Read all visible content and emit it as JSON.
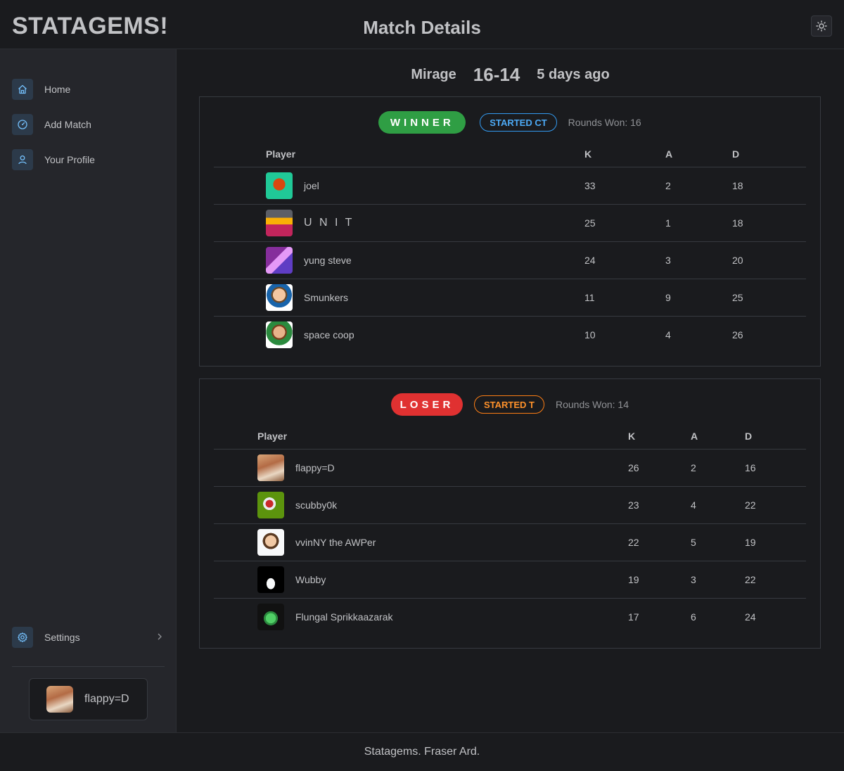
{
  "app": {
    "brand": "STATAGEMS!",
    "page_title": "Match Details"
  },
  "sidebar": {
    "items": [
      {
        "label": "Home",
        "icon": "home-icon"
      },
      {
        "label": "Add Match",
        "icon": "gauge-icon"
      },
      {
        "label": "Your Profile",
        "icon": "user-icon"
      }
    ],
    "settings": {
      "label": "Settings",
      "icon": "gear-icon"
    },
    "user": {
      "name": "flappy=D"
    }
  },
  "match": {
    "map": "Mirage",
    "score": "16-14",
    "time_ago": "5 days ago"
  },
  "columns": {
    "player": "Player",
    "k": "K",
    "a": "A",
    "d": "D"
  },
  "teams": [
    {
      "result": "WINNER",
      "side": "STARTED CT",
      "rounds_won": "Rounds Won: 16",
      "players": [
        {
          "name": "joel",
          "k": "33",
          "a": "2",
          "d": "18"
        },
        {
          "name": "U N I T",
          "k": "25",
          "a": "1",
          "d": "18"
        },
        {
          "name": "yung steve",
          "k": "24",
          "a": "3",
          "d": "20"
        },
        {
          "name": "Smunkers",
          "k": "11",
          "a": "9",
          "d": "25"
        },
        {
          "name": "space coop",
          "k": "10",
          "a": "4",
          "d": "26"
        }
      ]
    },
    {
      "result": "LOSER",
      "side": "STARTED T",
      "rounds_won": "Rounds Won: 14",
      "players": [
        {
          "name": "flappy=D",
          "k": "26",
          "a": "2",
          "d": "16"
        },
        {
          "name": "scubby0k",
          "k": "23",
          "a": "4",
          "d": "22"
        },
        {
          "name": "vvinNY the AWPer",
          "k": "22",
          "a": "5",
          "d": "19"
        },
        {
          "name": "Wubby",
          "k": "19",
          "a": "3",
          "d": "22"
        },
        {
          "name": "Flungal Sprikkaazarak",
          "k": "17",
          "a": "6",
          "d": "24"
        }
      ]
    }
  ],
  "footer": {
    "text": "Statagems. Fraser Ard."
  },
  "colors": {
    "winner": "#2f9e44",
    "loser": "#e03131",
    "ct": "#4dabf7",
    "t": "#ff922b"
  }
}
